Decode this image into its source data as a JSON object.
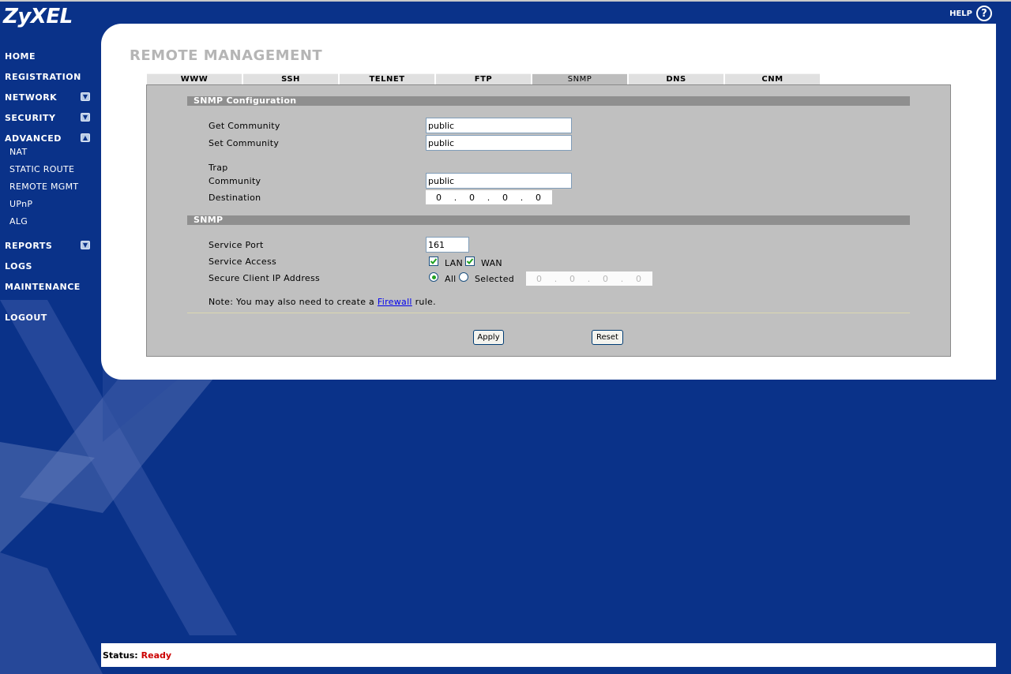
{
  "brand": {
    "logo": "ZyXEL",
    "help_label": "HELP",
    "help_glyph": "?"
  },
  "nav": {
    "home": "HOME",
    "registration": "REGISTRATION",
    "network": "NETWORK",
    "security": "SECURITY",
    "advanced": "ADVANCED",
    "advanced_items": [
      "NAT",
      "STATIC ROUTE",
      "REMOTE MGMT",
      "UPnP",
      "ALG"
    ],
    "reports": "REPORTS",
    "logs": "LOGS",
    "maintenance": "MAINTENANCE",
    "logout": "LOGOUT",
    "expand_glyph": "▼",
    "collapse_glyph": "▲"
  },
  "page": {
    "title": "REMOTE MANAGEMENT"
  },
  "tabs": [
    "WWW",
    "SSH",
    "TELNET",
    "FTP",
    "SNMP",
    "DNS",
    "CNM"
  ],
  "active_tab": "SNMP",
  "snmp_config": {
    "header": "SNMP Configuration",
    "get_community_label": "Get Community",
    "get_community_value": "public",
    "set_community_label": "Set Community",
    "set_community_value": "public",
    "trap_label": "Trap",
    "trap_community_label": "Community",
    "trap_community_value": "public",
    "destination_label": "Destination",
    "destination_ip": [
      "0",
      "0",
      "0",
      "0"
    ]
  },
  "snmp": {
    "header": "SNMP",
    "service_port_label": "Service Port",
    "service_port_value": "161",
    "service_access_label": "Service Access",
    "lan_label": "LAN",
    "lan_checked": true,
    "wan_label": "WAN",
    "wan_checked": true,
    "secure_ip_label": "Secure Client IP Address",
    "all_label": "All",
    "all_selected": true,
    "selected_label": "Selected",
    "selected_ip": [
      "0",
      "0",
      "0",
      "0"
    ],
    "note_prefix": "Note: You may also need to create a ",
    "note_link": "Firewall",
    "note_suffix": " rule."
  },
  "buttons": {
    "apply": "Apply",
    "reset": "Reset"
  },
  "status": {
    "label": "Status:",
    "value": "Ready"
  },
  "colors": {
    "background": "#0a3289",
    "status_value": "#cc0000",
    "section_bar": "#8f8f8f"
  }
}
